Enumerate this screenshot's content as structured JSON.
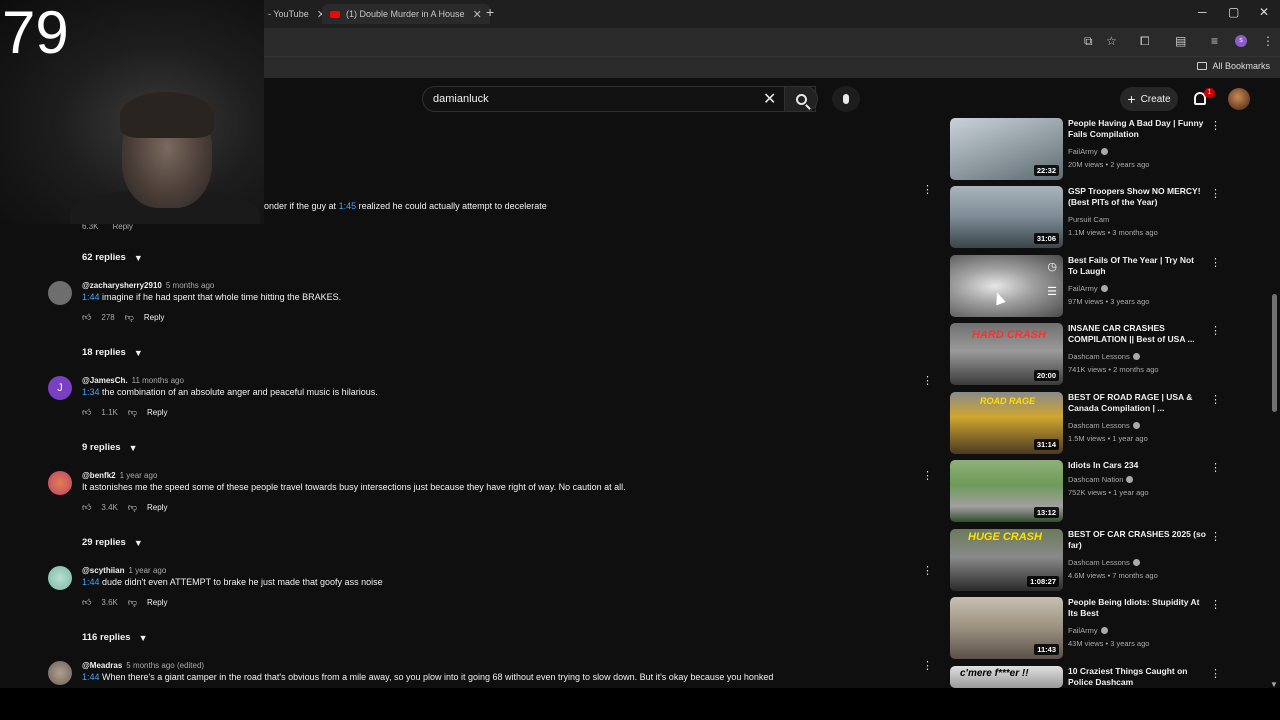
{
  "browser": {
    "tabs": [
      {
        "label": "- YouTube",
        "active": true
      },
      {
        "label": "(1) Double Murder in A House",
        "active": false
      }
    ],
    "new_tab": "+",
    "window_controls": [
      "─",
      "▢",
      "✕"
    ],
    "bookmarks": {
      "all_bookmarks": "All Bookmarks"
    },
    "profile_initial": "s"
  },
  "webcam": {
    "overlay_number": "79"
  },
  "topbar": {
    "search_value": "damianluck",
    "create_label": "Create",
    "notification_count": "1"
  },
  "comments": {
    "partial": {
      "prefix": "onder if the guy at ",
      "timestamp": "1:45",
      "suffix": " realized he could actually attempt to decelerate",
      "likes": "6.3K",
      "reply_label": "Reply"
    },
    "reply_toggles": [
      "62 replies",
      "18 replies",
      "9 replies",
      "29 replies",
      "116 replies"
    ],
    "items": [
      {
        "handle": "@zacharysherry2910",
        "time": "5 months ago",
        "timestamp": "1:44",
        "text": " imagine if he had spent that whole time hitting the BRAKES.",
        "likes": "278",
        "reply_label": "Reply",
        "avatar_color": "#6e6e6e",
        "avatar_letter": ""
      },
      {
        "handle": "@JamesCh.",
        "time": "11 months ago",
        "timestamp": "1:34",
        "text": " the combination of an absolute anger and peaceful music is hilarious.",
        "likes": "1.1K",
        "reply_label": "Reply",
        "avatar_color": "#7b3fc4",
        "avatar_letter": "J"
      },
      {
        "handle": "@benfk2",
        "time": "1 year ago",
        "timestamp": "",
        "text": "It astonishes me the speed some of these people travel towards busy intersections just because they have right of way. No caution at all.",
        "likes": "3.4K",
        "reply_label": "Reply",
        "avatar_color": "#c2406a",
        "avatar_letter": ""
      },
      {
        "handle": "@scythiian",
        "time": "1 year ago",
        "timestamp": "1:44",
        "text": " dude didn't even ATTEMPT to brake he just made that goofy ass noise",
        "likes": "3.6K",
        "reply_label": "Reply",
        "avatar_color": "#7ab8a0",
        "avatar_letter": ""
      },
      {
        "handle": "@Meadras",
        "time": "5 months ago (edited)",
        "timestamp": "1:44",
        "text": " When there's a giant camper in the road that's obvious from a mile away, so you plow into it going 68 without even trying to slow down. But it's okay because you honked",
        "likes": "",
        "reply_label": "",
        "avatar_color": "#8a8078",
        "avatar_letter": ""
      }
    ]
  },
  "sidebar": {
    "items": [
      {
        "title": "People Having A Bad Day | Funny Fails Compilation",
        "channel": "FailArmy",
        "verified": true,
        "stats": "20M views • 2 years ago",
        "duration": "22:32",
        "thumb_colors": [
          "#b9c4cc",
          "#6b7d86"
        ],
        "overlay": ""
      },
      {
        "title": "GSP Troopers Show NO MERCY! (Best PITs of the Year)",
        "channel": "Pursuit Cam",
        "verified": false,
        "stats": "1.1M views • 3 months ago",
        "duration": "31:06",
        "thumb_colors": [
          "#9aa7b0",
          "#3e4a52"
        ],
        "overlay": ""
      },
      {
        "title": "Best Fails Of The Year | Try Not To Laugh",
        "channel": "FailArmy",
        "verified": true,
        "stats": "97M views • 3 years ago",
        "duration": "",
        "thumb_colors": [
          "#d8d8d8",
          "#5a5a5a"
        ],
        "overlay": ""
      },
      {
        "title": "INSANE CAR CRASHES COMPILATION || Best of USA ...",
        "channel": "Dashcam Lessons",
        "verified": true,
        "stats": "741K views • 2 months ago",
        "duration": "20:00",
        "thumb_colors": [
          "#8c8c8c",
          "#3a3a3a"
        ],
        "overlay": "HARD CRASH"
      },
      {
        "title": "BEST OF ROAD RAGE | USA & Canada Compilation | ...",
        "channel": "Dashcam Lessons",
        "verified": true,
        "stats": "1.5M views • 1 year ago",
        "duration": "31:14",
        "thumb_colors": [
          "#d0a630",
          "#4a3a22"
        ],
        "overlay": "ROAD RAGE"
      },
      {
        "title": "Idiots In Cars 234",
        "channel": "Dashcam Nation",
        "verified": true,
        "stats": "752K views • 1 year ago",
        "duration": "13:12",
        "thumb_colors": [
          "#6f9a58",
          "#2f4f2a"
        ],
        "overlay": ""
      },
      {
        "title": "BEST OF CAR CRASHES 2025 (so far)",
        "channel": "Dashcam Lessons",
        "verified": true,
        "stats": "4.6M views • 7 months ago",
        "duration": "1:08:27",
        "thumb_colors": [
          "#6a7a5a",
          "#2a2a2a"
        ],
        "overlay": "HUGE CRASH"
      },
      {
        "title": "People Being Idiots: Stupidity At Its Best",
        "channel": "FailArmy",
        "verified": true,
        "stats": "43M views • 3 years ago",
        "duration": "11:43",
        "thumb_colors": [
          "#c7c0b0",
          "#5a5048"
        ],
        "overlay": ""
      },
      {
        "title": "10 Craziest Things Caught on Police Dashcam",
        "channel": "",
        "verified": false,
        "stats": "",
        "duration": "",
        "thumb_colors": [
          "#d8d8d8",
          "#9a9a9a"
        ],
        "overlay": "c'mere f***er !!"
      }
    ]
  },
  "colors": {
    "background": "#0f0f0f",
    "link": "#3ea6ff",
    "brand_red": "#ff0000",
    "text": "#f1f1f1",
    "muted": "#aaaaaa"
  }
}
